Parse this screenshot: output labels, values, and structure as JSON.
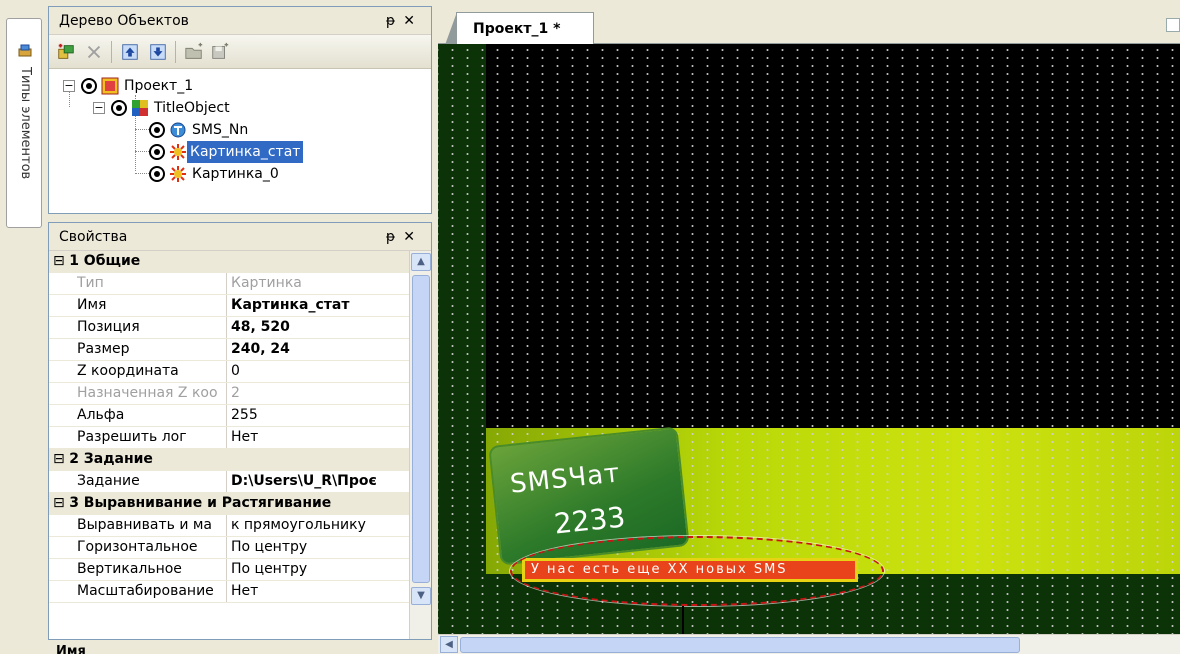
{
  "toolbox": {
    "label": "Типы элементов"
  },
  "tree_panel": {
    "title": "Дерево Объектов",
    "pin": "ᵽ",
    "close": "✕",
    "nodes": [
      {
        "label": "Проект_1",
        "expander": "−"
      },
      {
        "label": "TitleObject",
        "expander": "−"
      },
      {
        "label": "SMS_Nn"
      },
      {
        "label": "Картинка_стат",
        "selected": true
      },
      {
        "label": "Картинка_0"
      }
    ]
  },
  "props_panel": {
    "title": "Свойства",
    "pin": "ᵽ",
    "close": "✕",
    "rows": [
      {
        "k": "1 Общие",
        "cat": true
      },
      {
        "k": "Тип",
        "v": "Картинка",
        "dis": true
      },
      {
        "k": "Имя",
        "v": "Картинка_стат",
        "bold": true
      },
      {
        "k": "Позиция",
        "v": "48, 520",
        "bold": true
      },
      {
        "k": "Размер",
        "v": "240, 24",
        "bold": true
      },
      {
        "k": "Z координата",
        "v": "0"
      },
      {
        "k": "Назначенная Z коо",
        "v": "2",
        "dis": true
      },
      {
        "k": "Альфа",
        "v": "255"
      },
      {
        "k": "Разрешить лог",
        "v": "Нет"
      },
      {
        "k": "2 Задание",
        "cat": true
      },
      {
        "k": "Задание",
        "v": "D:\\Users\\U_R\\Проє",
        "bold": true
      },
      {
        "k": "3 Выравнивание и Растягивание",
        "cat": true
      },
      {
        "k": "Выравнивать и ма",
        "v": "к прямоугольнику"
      },
      {
        "k": "Горизонтальное",
        "v": "По центру"
      },
      {
        "k": "Вертикальное",
        "v": "По центру"
      },
      {
        "k": "Масштабирование",
        "v": "Нет"
      }
    ],
    "bottom_label": "Имя"
  },
  "document": {
    "tab_label": "Проект_1 *",
    "banner": {
      "logo_title": "SMSЧат",
      "logo_number": "2233",
      "strip_text": "У нас есть еще XX новых SMS"
    }
  }
}
